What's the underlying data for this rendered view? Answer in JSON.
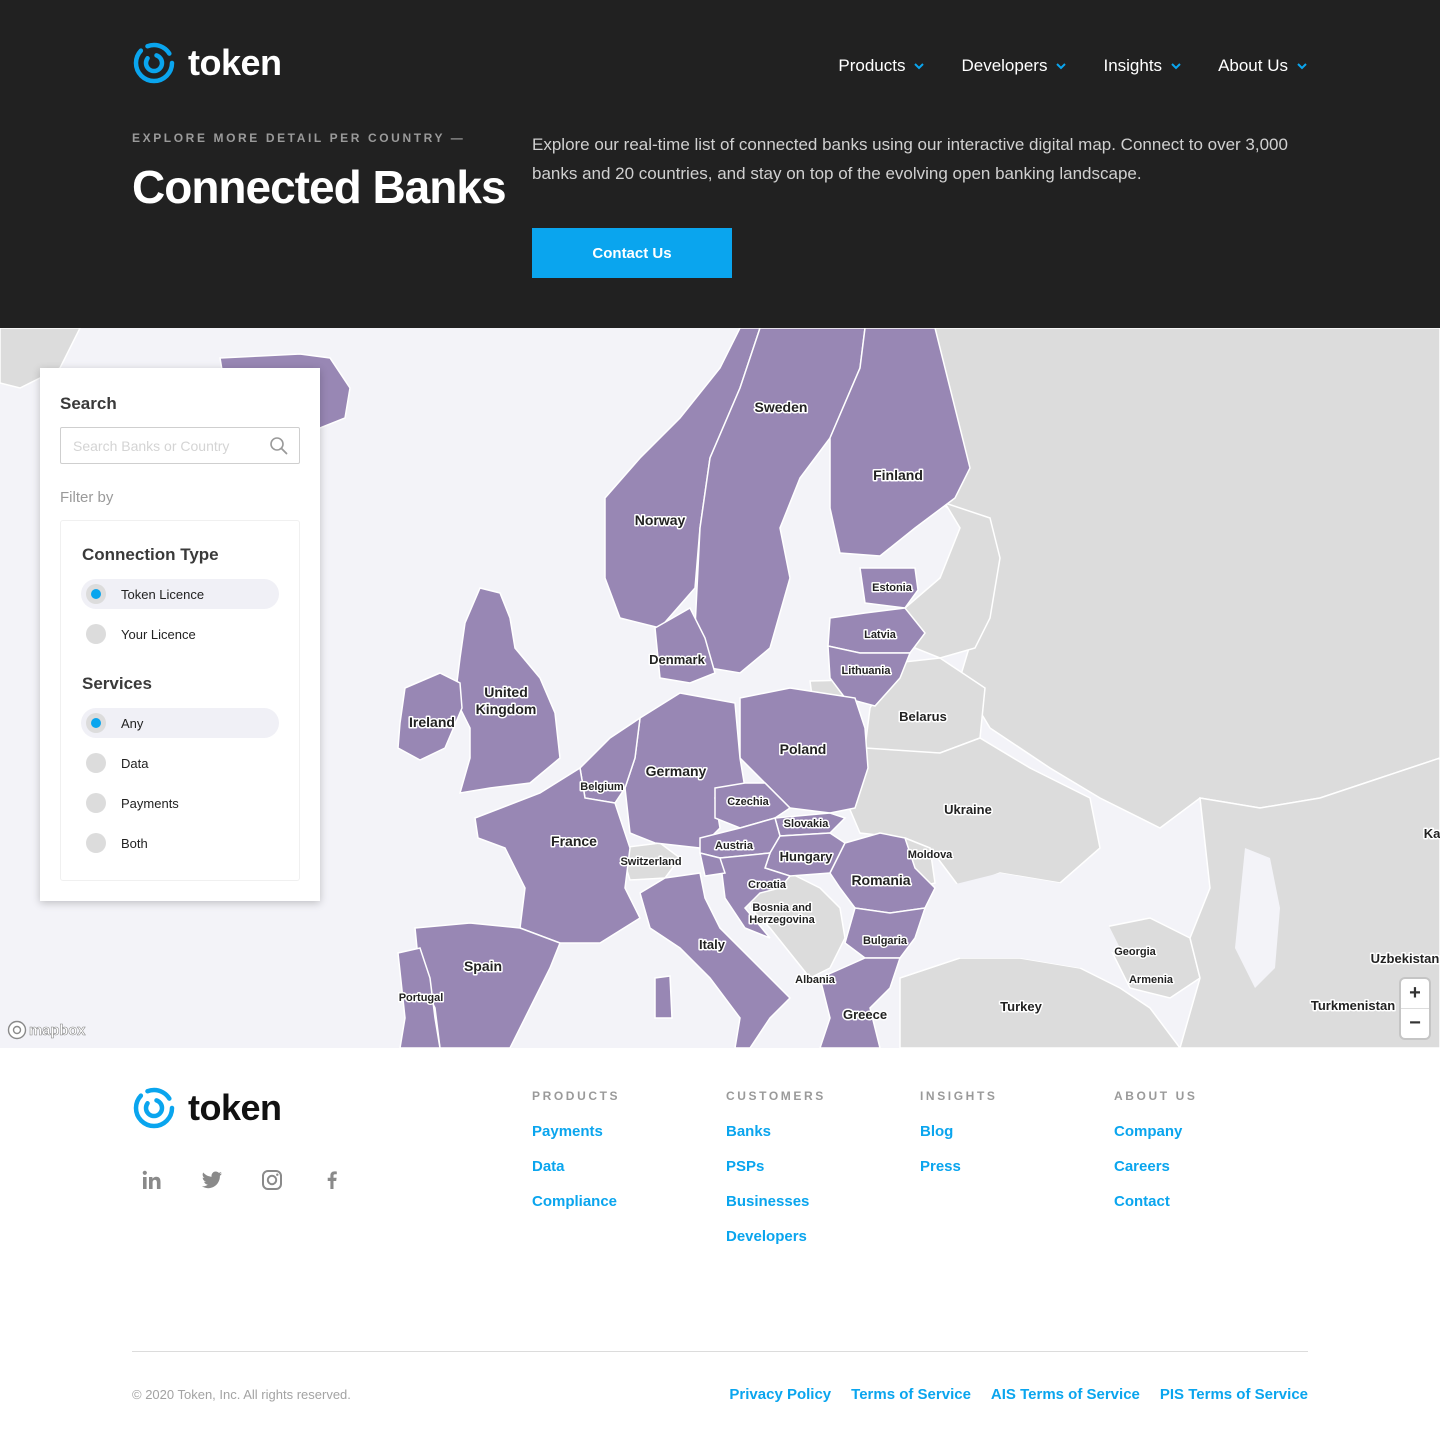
{
  "brand": {
    "name": "token",
    "accent": "#0aa5ee",
    "hero_bg": "#212121",
    "map_connected": "#9887b4",
    "map_other": "#dcdcdc"
  },
  "nav": {
    "items": [
      {
        "label": "Products",
        "icon": "chevron-down-icon"
      },
      {
        "label": "Developers",
        "icon": "chevron-down-icon"
      },
      {
        "label": "Insights",
        "icon": "chevron-down-icon"
      },
      {
        "label": "About Us",
        "icon": "chevron-down-icon"
      }
    ]
  },
  "hero": {
    "eyebrow": "EXPLORE MORE DETAIL PER COUNTRY —",
    "title": "Connected Banks",
    "description": "Explore our real-time list of connected banks using our interactive digital map. Connect to over 3,000 banks and 20 countries, and stay on top of the evolving open banking landscape.",
    "cta_label": "Contact Us"
  },
  "filters": {
    "search_title": "Search",
    "search_placeholder": "Search Banks or Country",
    "filter_by": "Filter by",
    "connection_type": {
      "title": "Connection Type",
      "options": [
        {
          "label": "Token Licence",
          "selected": true
        },
        {
          "label": "Your Licence",
          "selected": false
        }
      ]
    },
    "services": {
      "title": "Services",
      "options": [
        {
          "label": "Any",
          "selected": true
        },
        {
          "label": "Data",
          "selected": false
        },
        {
          "label": "Payments",
          "selected": false
        },
        {
          "label": "Both",
          "selected": false
        }
      ]
    }
  },
  "map": {
    "labels": {
      "sweden": "Sweden",
      "finland": "Finland",
      "norway": "Norway",
      "estonia": "Estonia",
      "latvia": "Latvia",
      "lithuania": "Lithuania",
      "denmark": "Denmark",
      "uk_line1": "United",
      "uk_line2": "Kingdom",
      "ireland": "Ireland",
      "belarus": "Belarus",
      "poland": "Poland",
      "germany": "Germany",
      "belgium": "Belgium",
      "czechia": "Czechia",
      "slovakia": "Slovakia",
      "ukraine": "Ukraine",
      "france": "France",
      "austria": "Austria",
      "hungary": "Hungary",
      "moldova": "Moldova",
      "switzerland": "Switzerland",
      "romania": "Romania",
      "croatia": "Croatia",
      "bosnia_line1": "Bosnia and",
      "bosnia_line2": "Herzegovina",
      "italy": "Italy",
      "bulgaria": "Bulgaria",
      "georgia": "Georgia",
      "spain": "Spain",
      "armenia": "Armenia",
      "albania": "Albania",
      "portugal": "Portugal",
      "turkey": "Turkey",
      "turkmenistan": "Turkmenistan",
      "greece": "Greece",
      "uzbekistan": "Uzbekistan",
      "ka": "Ka"
    },
    "zoom_in": "+",
    "zoom_out": "−",
    "attribution": "mapbox"
  },
  "footer": {
    "brand": "token",
    "social": [
      "linkedin-icon",
      "twitter-icon",
      "instagram-icon",
      "facebook-icon"
    ],
    "columns": [
      {
        "title": "PRODUCTS",
        "links": [
          "Payments",
          "Data",
          "Compliance"
        ]
      },
      {
        "title": "CUSTOMERS",
        "links": [
          "Banks",
          "PSPs",
          "Businesses",
          "Developers"
        ]
      },
      {
        "title": "INSIGHTS",
        "links": [
          "Blog",
          "Press"
        ]
      },
      {
        "title": "ABOUT US",
        "links": [
          "Company",
          "Careers",
          "Contact"
        ]
      }
    ],
    "copyright": "© 2020 Token, Inc. All rights reserved.",
    "legal": [
      "Privacy Policy",
      "Terms of Service",
      "AIS Terms of Service",
      "PIS Terms of Service"
    ]
  }
}
